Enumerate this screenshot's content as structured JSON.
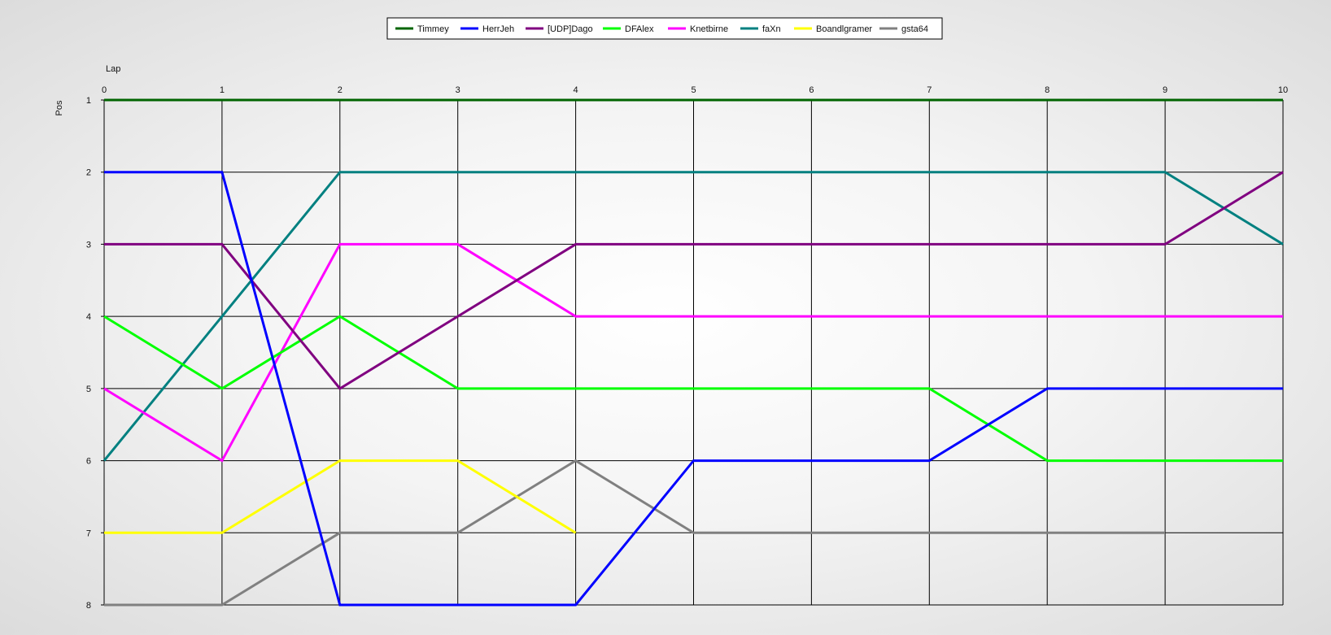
{
  "chart_data": {
    "type": "line",
    "xlabel": "Lap",
    "ylabel": "Pos",
    "x": [
      0,
      1,
      2,
      3,
      4,
      5,
      6,
      7,
      8,
      9,
      10
    ],
    "xlim": [
      0,
      10
    ],
    "ylim": [
      1,
      8
    ],
    "y_inverted": true,
    "x_axis_position": "top",
    "grid": true,
    "legend_position": "top-center",
    "series": [
      {
        "name": "Timmey",
        "color": "#006400",
        "values": [
          1,
          1,
          1,
          1,
          1,
          1,
          1,
          1,
          1,
          1,
          1
        ]
      },
      {
        "name": "HerrJeh",
        "color": "#0000ff",
        "values": [
          2,
          2,
          8,
          8,
          8,
          6,
          6,
          6,
          5,
          5,
          5
        ]
      },
      {
        "name": "[UDP]Dago",
        "color": "#800080",
        "values": [
          3,
          3,
          5,
          4,
          3,
          3,
          3,
          3,
          3,
          3,
          2
        ]
      },
      {
        "name": "DFAlex",
        "color": "#00ff00",
        "values": [
          4,
          5,
          4,
          5,
          5,
          5,
          5,
          5,
          6,
          6,
          6
        ]
      },
      {
        "name": "Knetbirne",
        "color": "#ff00ff",
        "values": [
          5,
          6,
          3,
          3,
          4,
          4,
          4,
          4,
          4,
          4,
          4
        ]
      },
      {
        "name": "faXn",
        "color": "#008080",
        "values": [
          6,
          4,
          2,
          2,
          2,
          2,
          2,
          2,
          2,
          2,
          3
        ]
      },
      {
        "name": "Boandlgramer",
        "color": "#ffff00",
        "values": [
          7,
          7,
          6,
          6,
          7,
          null,
          null,
          null,
          null,
          null,
          null
        ]
      },
      {
        "name": "gsta64",
        "color": "#808080",
        "values": [
          8,
          8,
          7,
          7,
          6,
          7,
          7,
          7,
          7,
          7,
          null
        ]
      }
    ]
  }
}
